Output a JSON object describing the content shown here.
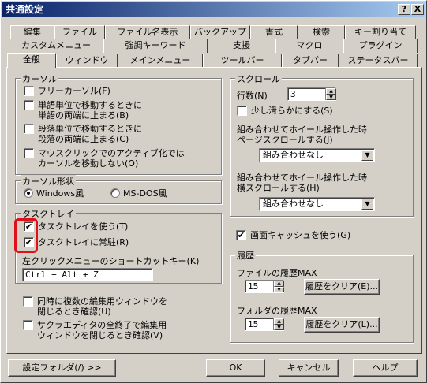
{
  "window": {
    "title": "共通設定"
  },
  "titlebar_buttons": {
    "help": "?",
    "close": "X"
  },
  "tabs_row1": [
    "編集",
    "ファイル",
    "ファイル名表示",
    "バックアップ",
    "書式",
    "検索",
    "キー割り当て"
  ],
  "tabs_row2": [
    "カスタムメニュー",
    "強調キーワード",
    "支援",
    "マクロ",
    "プラグイン"
  ],
  "tabs_row3": [
    "全般",
    "ウィンドウ",
    "メインメニュー",
    "ツールバー",
    "タブバー",
    "ステータスバー"
  ],
  "cursor": {
    "group_label": "カーソル",
    "free_cursor": "フリーカーソル(F)",
    "word_move_1": "単語単位で移動するときに",
    "word_move_2": "単語の両端に止まる(B)",
    "para_move_1": "段落単位で移動するときに",
    "para_move_2": "段落の両端に止まる(C)",
    "mouse_activate_1": "マウスクリックでのアクティブ化では",
    "mouse_activate_2": "カーソルを移動しない(O)"
  },
  "cursor_shape": {
    "group_label": "カーソル形状",
    "windows": "Windows風",
    "msdos": "MS-DOS風",
    "selected": "Windows風"
  },
  "tasktray": {
    "group_label": "タスクトレイ",
    "use": "タスクトレイを使う(T)",
    "use_checked": "✔",
    "resident": "タスクトレイに常駐(R)",
    "resident_checked": "✔",
    "shortcut_label": "左クリックメニューのショートカットキー(K)",
    "shortcut_value": "Ctrl + Alt + Z"
  },
  "misc": {
    "multi_close_1": "同時に複数の編集用ウィンドウを",
    "multi_close_2": "閉じるとき確認(U)",
    "exit_close_1": "サクラエディタの全終了で編集用",
    "exit_close_2": "ウィンドウを閉じるとき確認(V)"
  },
  "scroll": {
    "group_label": "スクロール",
    "lines_label": "行数(N)",
    "lines_value": "3",
    "smooth": "少し滑らかにする(S)",
    "page_combo_label_1": "組み合わせてホイール操作した時",
    "page_combo_label_2": "ページスクロールする(J)",
    "page_combo_value": "組み合わせなし",
    "horiz_combo_label_1": "組み合わせてホイール操作した時",
    "horiz_combo_label_2": "横スクロールする(H)",
    "horiz_combo_value": "組み合わせなし"
  },
  "screen_cache": {
    "label": "画面キャッシュを使う(G)",
    "checked": "✔"
  },
  "history": {
    "group_label": "履歴",
    "file_label": "ファイルの履歴MAX",
    "file_value": "15",
    "file_clear": "履歴をクリア(E)...",
    "folder_label": "フォルダの履歴MAX",
    "folder_value": "15",
    "folder_clear": "履歴をクリア(L)..."
  },
  "bottom_buttons": {
    "settings_folder": "設定フォルダ(/) >>",
    "ok": "OK",
    "cancel": "キャンセル",
    "help": "ヘルプ"
  },
  "highlight_color": "#e0101a"
}
